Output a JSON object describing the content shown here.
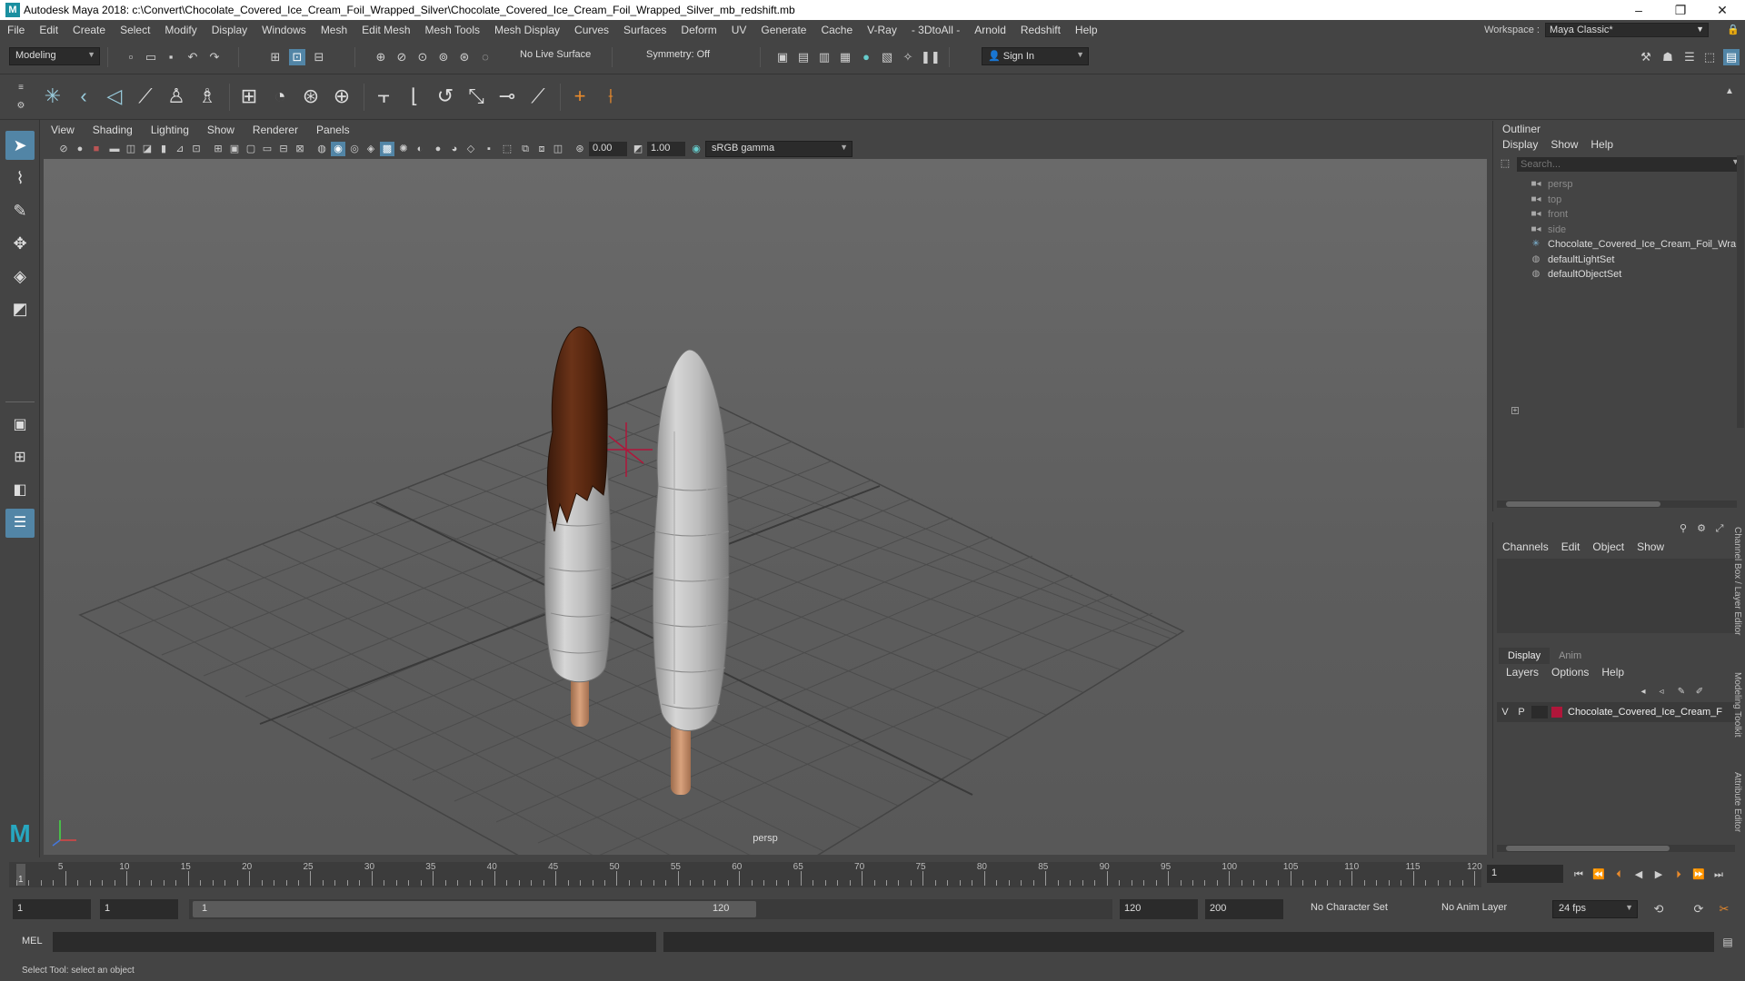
{
  "window": {
    "title": "Autodesk Maya 2018: c:\\Convert\\Chocolate_Covered_Ice_Cream_Foil_Wrapped_Silver\\Chocolate_Covered_Ice_Cream_Foil_Wrapped_Silver_mb_redshift.mb",
    "logo": "M",
    "minimize": "–",
    "restore": "❐",
    "close": "✕"
  },
  "menubar": {
    "items": [
      "File",
      "Edit",
      "Create",
      "Select",
      "Modify",
      "Display",
      "Windows",
      "Mesh",
      "Edit Mesh",
      "Mesh Tools",
      "Mesh Display",
      "Curves",
      "Surfaces",
      "Deform",
      "UV",
      "Generate",
      "Cache",
      "V-Ray",
      "- 3DtoAll -",
      "Arnold",
      "Redshift",
      "Help"
    ],
    "workspace_label": "Workspace :",
    "workspace_value": "Maya Classic*"
  },
  "statusline": {
    "mode": "Modeling",
    "live_surface": "No Live Surface",
    "symmetry": "Symmetry: Off",
    "sign_in": "Sign In"
  },
  "viewport": {
    "menu": [
      "View",
      "Shading",
      "Lighting",
      "Show",
      "Renderer",
      "Panels"
    ],
    "exposure": "0.00",
    "gamma": "1.00",
    "color_space": "sRGB gamma",
    "camera_label": "persp"
  },
  "outliner": {
    "title": "Outliner",
    "menu": [
      "Display",
      "Show",
      "Help"
    ],
    "search_placeholder": "Search...",
    "items": [
      {
        "label": "persp",
        "icon": "camera-icon",
        "dim": true
      },
      {
        "label": "top",
        "icon": "camera-icon",
        "dim": true
      },
      {
        "label": "front",
        "icon": "camera-icon",
        "dim": true
      },
      {
        "label": "side",
        "icon": "camera-icon",
        "dim": true
      },
      {
        "label": "Chocolate_Covered_Ice_Cream_Foil_Wra",
        "icon": "group-icon",
        "dim": false
      },
      {
        "label": "defaultLightSet",
        "icon": "set-icon",
        "dim": false
      },
      {
        "label": "defaultObjectSet",
        "icon": "set-icon",
        "dim": false
      }
    ]
  },
  "channelbox": {
    "menu": [
      "Channels",
      "Edit",
      "Object",
      "Show"
    ],
    "tabs": [
      "Display",
      "Anim"
    ],
    "layer_menu": [
      "Layers",
      "Options",
      "Help"
    ],
    "layer": {
      "v": "V",
      "p": "P",
      "name": "Chocolate_Covered_Ice_Cream_F",
      "color": "#b0163a"
    }
  },
  "side_tabs": [
    "Channel Box / Layer Editor",
    "Modeling Toolkit",
    "Attribute Editor"
  ],
  "timeline": {
    "ticks": [
      "5",
      "10",
      "15",
      "20",
      "25",
      "30",
      "35",
      "40",
      "45",
      "50",
      "55",
      "60",
      "65",
      "70",
      "75",
      "80",
      "85",
      "90",
      "95",
      "100",
      "105",
      "110",
      "115",
      "120"
    ],
    "start_marker": "1",
    "current_frame": "1"
  },
  "range": {
    "start": "1",
    "playback_start": "1",
    "slider_start": "1",
    "slider_end": "120",
    "playback_end": "120",
    "end": "200",
    "character_set": "No Character Set",
    "anim_layer": "No Anim Layer",
    "fps": "24 fps"
  },
  "cmdline": {
    "label": "MEL"
  },
  "helpline": {
    "text": "Select Tool: select an object"
  }
}
